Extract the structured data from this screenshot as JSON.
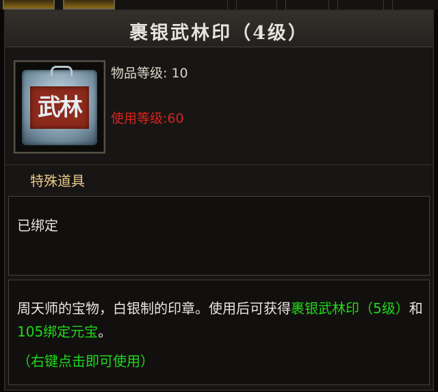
{
  "tooltip": {
    "title": "裹银武林印（4级）",
    "item_level": "物品等级: 10",
    "use_level": "使用等级:60",
    "category": "特殊道具",
    "bind_status": "已绑定",
    "icon_text": "武林",
    "description": {
      "text_1": "周天师的宝物，白银制的印章。使用后可获得",
      "link_1": "裹银武林印（5级）",
      "text_2": "和",
      "link_2": "105绑定元宝",
      "text_3": "。"
    },
    "hint": "（右键点击即可使用）"
  },
  "colors": {
    "title": "#e6e3dc",
    "use_level_red": "#d8241c",
    "category_gold": "#e8c88c",
    "highlight_green": "#1fd81c"
  },
  "icons": {
    "item_icon": "silver-martial-seal-icon"
  }
}
